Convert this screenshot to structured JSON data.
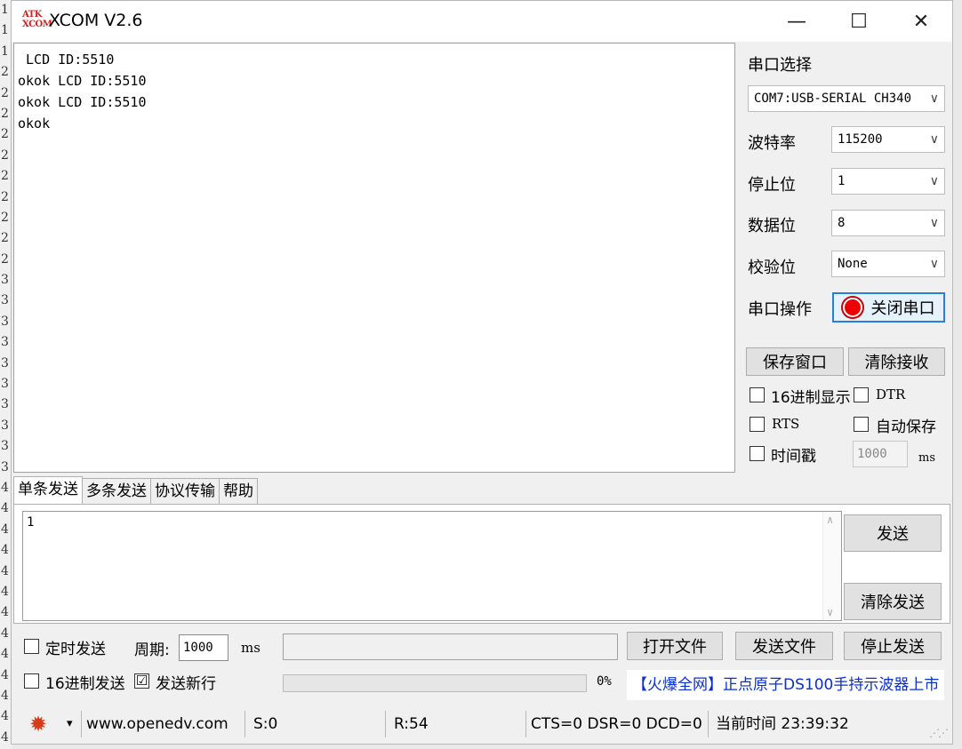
{
  "gutter": [
    "1",
    "1",
    "1",
    "2",
    "2",
    "2",
    "2",
    "2",
    "2",
    "2",
    "2",
    "2",
    "2",
    "3",
    "3",
    "3",
    "3",
    "3",
    "3",
    "3",
    "3",
    "3",
    "3",
    "4",
    "4",
    "4",
    "4",
    "4",
    "4",
    "4",
    "4",
    "4",
    "4",
    "4",
    "4",
    "4"
  ],
  "window": {
    "title": "XCOM V2.6",
    "logo": {
      "top": "ATK",
      "bottom": "XCOM"
    },
    "minimize_glyph": "—",
    "maximize_glyph": "☐",
    "close_glyph": "✕"
  },
  "receive": {
    "text": " LCD ID:5510\nokok LCD ID:5510\nokok LCD ID:5510\nokok"
  },
  "settings": {
    "port_label": "串口选择",
    "port_value": "COM7:USB-SERIAL CH340",
    "baud_label": "波特率",
    "baud_value": "115200",
    "stop_label": "停止位",
    "stop_value": "1",
    "data_label": "数据位",
    "data_value": "8",
    "parity_label": "校验位",
    "parity_value": "None",
    "op_label": "串口操作",
    "op_button": "关闭串口",
    "dropdown_arrow": "∨"
  },
  "actions": {
    "save_window": "保存窗口",
    "clear_receive": "清除接收"
  },
  "options": {
    "hex_display": "16进制显示",
    "dtr": "DTR",
    "rts": "RTS",
    "auto_save": "自动保存",
    "timestamp": "时间戳",
    "timestamp_ms_value": "1000",
    "ms": "ms"
  },
  "tabs": [
    "单条发送",
    "多条发送",
    "协议传输",
    "帮助"
  ],
  "send": {
    "text": "1",
    "send_button": "发送",
    "clear_send_button": "清除发送",
    "timed_send": "定时发送",
    "period_label": "周期:",
    "period_value": "1000",
    "period_unit": "ms",
    "open_file": "打开文件",
    "send_file": "发送文件",
    "stop_send": "停止发送",
    "hex_send": "16进制发送",
    "send_newline": "发送新行",
    "send_newline_checked": "☑",
    "progress_percent": "0%",
    "progress_value": 0,
    "ad_text": "【火爆全网】正点原子DS100手持示波器上市"
  },
  "status": {
    "website": "www.openedv.com",
    "sent": "S:0",
    "received": "R:54",
    "lines": "CTS=0 DSR=0 DCD=0",
    "time": "当前时间 23:39:32",
    "gear_glyph": "✹",
    "menu_caret": "▾"
  },
  "colors": {
    "accent": "#2a7fd4",
    "led": "#e00000",
    "link": "#0a2fcf",
    "gear": "#d83a1c"
  }
}
